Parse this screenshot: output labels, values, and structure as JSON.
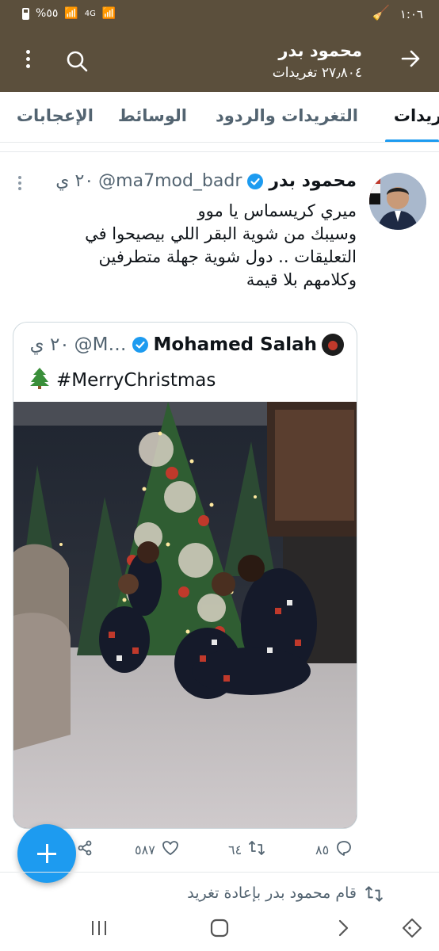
{
  "status_bar": {
    "time": "١:٠٦",
    "battery": "%٥٥",
    "network": "4G"
  },
  "header": {
    "title": "محمود بدر",
    "tweet_count": "٢٧٫٨٠٤ تغريدات"
  },
  "tabs": [
    {
      "label": "تغريدات",
      "active": true
    },
    {
      "label": "التغريدات والردود",
      "active": false
    },
    {
      "label": "الوسائط",
      "active": false
    },
    {
      "label": "الإعجابات",
      "active": false
    }
  ],
  "tweet": {
    "author_name": "محمود بدر",
    "handle": "@ma7mod_badr",
    "time": "٢٠ ي",
    "text_lines": [
      "ميري كريسماس يا موو",
      "وسيبك من شوية البقر اللي بيصيحوا في",
      "التعليقات .. دول شوية جهلة متطرفين",
      "وكلامهم بلا قيمة"
    ],
    "quote": {
      "author_name": "Mohamed Salah",
      "handle": "@M…",
      "time": "٢٠ ي",
      "text": "#MerryChristmas"
    },
    "actions": {
      "replies": "٨٥",
      "retweets": "٦٤",
      "likes": "٥٨٧"
    }
  },
  "retweet_note": "قام محمود بدر بإعادة تغريد",
  "colors": {
    "header_bg": "#5b4f3c",
    "accent": "#1d9bf0",
    "secondary_text": "#536471"
  }
}
